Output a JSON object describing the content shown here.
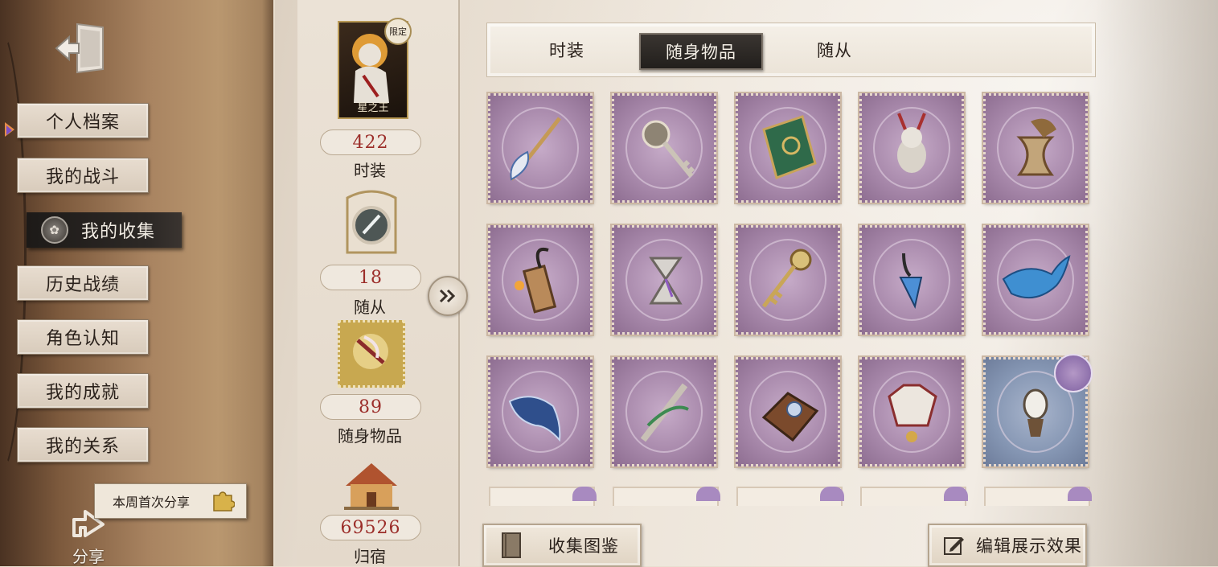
{
  "sidebar": {
    "menu": [
      {
        "label": "个人档案"
      },
      {
        "label": "我的战斗"
      },
      {
        "label": "我的收集",
        "active": true
      },
      {
        "label": "历史战绩"
      },
      {
        "label": "角色认知"
      },
      {
        "label": "我的成就"
      },
      {
        "label": "我的关系"
      }
    ],
    "share_tip": "本周首次分享",
    "share_label": "分享"
  },
  "stats": [
    {
      "value": "422",
      "label": "时装",
      "badge": "限定",
      "caption": "星之王"
    },
    {
      "value": "18",
      "label": "随从"
    },
    {
      "value": "89",
      "label": "随身物品"
    },
    {
      "value": "69526",
      "label": "归宿"
    }
  ],
  "tabs": [
    {
      "label": "时装"
    },
    {
      "label": "随身物品",
      "active": true
    },
    {
      "label": "随从"
    }
  ],
  "items": [
    {
      "icon": "feather-quill-icon"
    },
    {
      "icon": "sun-key-icon"
    },
    {
      "icon": "green-book-icon"
    },
    {
      "icon": "rabbit-doll-icon"
    },
    {
      "icon": "hourglass-horn-icon"
    },
    {
      "icon": "dynamite-hook-icon"
    },
    {
      "icon": "silver-hourglass-icon"
    },
    {
      "icon": "golden-key-icon"
    },
    {
      "icon": "crystal-pendant-icon"
    },
    {
      "icon": "blue-whale-icon"
    },
    {
      "icon": "night-whale-icon"
    },
    {
      "icon": "vine-dagger-icon"
    },
    {
      "icon": "gem-saddle-icon"
    },
    {
      "icon": "fox-mask-bell-icon"
    },
    {
      "icon": "lamp-lantern-icon",
      "rarity": "blue"
    }
  ],
  "buttons": {
    "collection_guide": "收集图鉴",
    "edit_display": "编辑展示效果"
  },
  "colors": {
    "stat_value": "#9c2e2a",
    "item_frame": "#a98aac",
    "active_tab": "#2a2623"
  }
}
